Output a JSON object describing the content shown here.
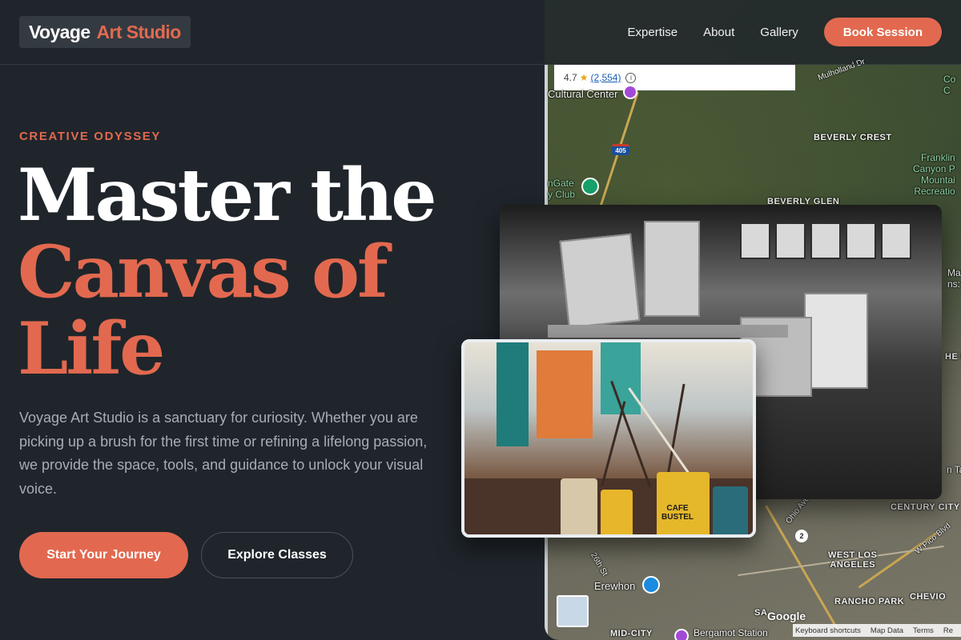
{
  "header": {
    "logo_primary": "Voyage",
    "logo_accent": "Art Studio",
    "nav": [
      "Expertise",
      "About",
      "Gallery"
    ],
    "cta": "Book Session"
  },
  "hero": {
    "eyebrow": "CREATIVE ODYSSEY",
    "headline_line1": "Master the",
    "headline_line2": "Canvas of",
    "headline_line3": "Life",
    "lede": "Voyage Art Studio is a sanctuary for curiosity. Whether you are picking up a brush for the first time or refining a lifelong passion, we provide the space, tools, and guidance to unlock your visual voice.",
    "primary_button": "Start Your Journey",
    "secondary_button": "Explore Classes"
  },
  "map": {
    "rating": "4.7",
    "rating_star": "★",
    "review_count": "(2,554)",
    "info_icon": "i",
    "labels": {
      "cultural_center": "Cultural Center",
      "beverly_crest": "BEVERLY CREST",
      "beverly_glen": "BEVERLY GLEN",
      "franklin": "Franklin\nCanyon P\nMountai\nRecreatio",
      "west_los_angeles": "WEST LOS\nANGELES",
      "rancho_park": "RANCHO PARK",
      "century_city": "CENTURY CITY",
      "cheviot": "CHEVIO",
      "erewhon": "Erewhon",
      "mid_city": "MID-CITY",
      "bergamot": "Bergamot Station",
      "sa": "SA",
      "mulholland": "Mulholland Dr",
      "ngate": "nGate\ny Club",
      "ohio_ave": "Ohio Ave",
      "pico": "W Pico Blvd",
      "st26": "26th St",
      "man": "Man\nns: T",
      "co": "Co\nC",
      "n_ta": "n Ta",
      "he_f": "HE F"
    },
    "highway": "405",
    "route": "2",
    "brand": "Google",
    "attribution": [
      "Keyboard shortcuts",
      "Map Data",
      "Terms",
      "Re"
    ]
  },
  "colors": {
    "accent": "#e2694f",
    "background": "#1f252b"
  },
  "photos": {
    "back": "studio-interior-bw",
    "front": "paint-jars-color"
  },
  "photo_text": {
    "jar_label": "CAFE\nBUSTEL"
  }
}
